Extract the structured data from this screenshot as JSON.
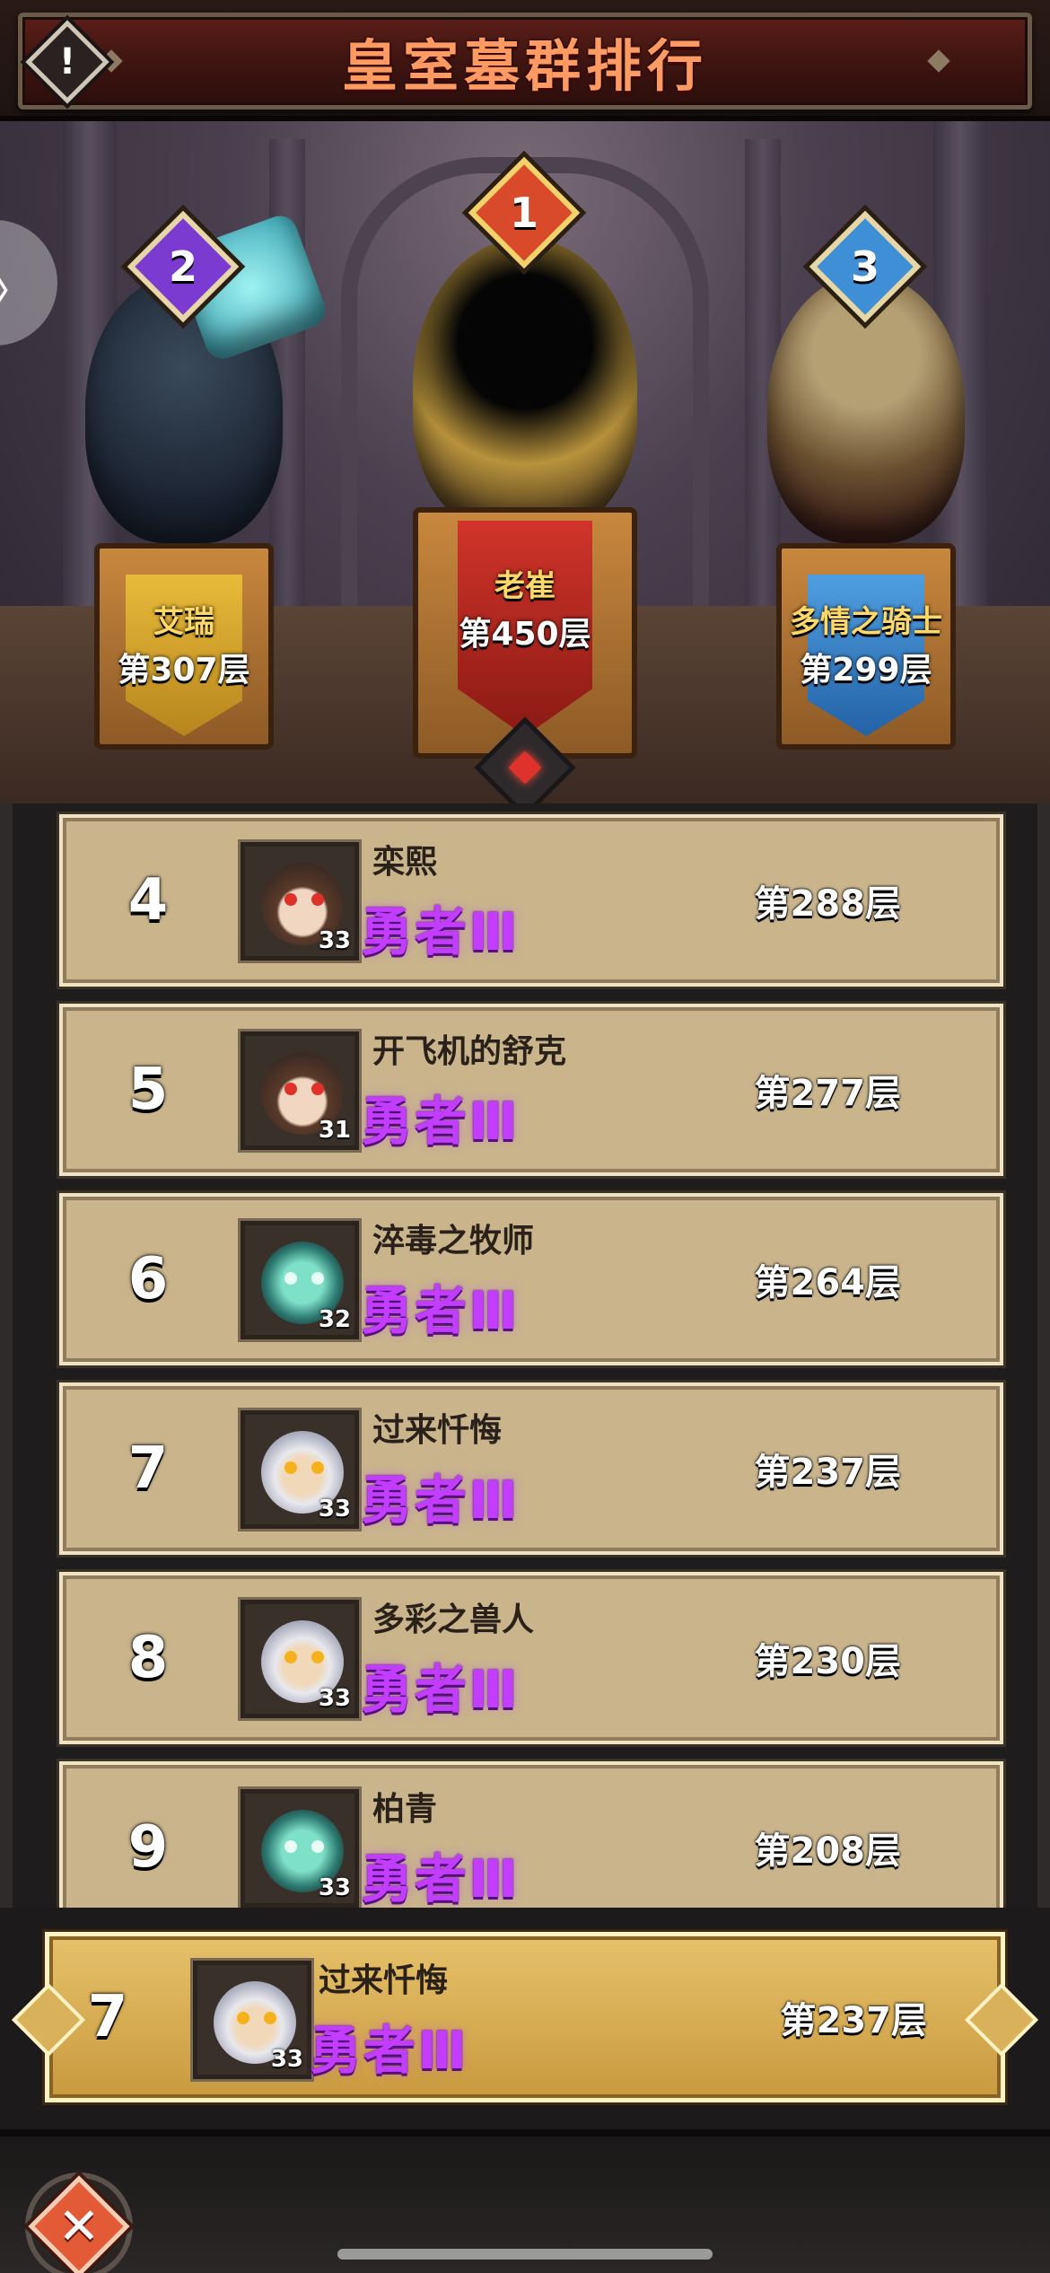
{
  "header": {
    "title": "皇室墓群排行",
    "info_icon": "!"
  },
  "side_tab": {
    "icon": "chevron-right",
    "glyph": "〉"
  },
  "podium": [
    {
      "rank": "2",
      "name": "艾瑞",
      "floor": "第307层",
      "badge_color": "#7b3bd1"
    },
    {
      "rank": "1",
      "name": "老崔",
      "floor": "第450层",
      "badge_color": "#d84a2a"
    },
    {
      "rank": "3",
      "name": "多情之骑士",
      "floor": "第299层",
      "badge_color": "#3f8fd6"
    }
  ],
  "rankings": [
    {
      "rank": "4",
      "name": "栾熙",
      "title": "勇者Ⅲ",
      "level": "33",
      "floor": "第288层",
      "avatar": "hooded"
    },
    {
      "rank": "5",
      "name": "开飞机的舒克",
      "title": "勇者Ⅲ",
      "level": "31",
      "floor": "第277层",
      "avatar": "hooded"
    },
    {
      "rank": "6",
      "name": "淬毒之牧师",
      "title": "勇者Ⅲ",
      "level": "32",
      "floor": "第264层",
      "avatar": "teal"
    },
    {
      "rank": "7",
      "name": "过来忏悔",
      "title": "勇者Ⅲ",
      "level": "33",
      "floor": "第237层",
      "avatar": "white"
    },
    {
      "rank": "8",
      "name": "多彩之兽人",
      "title": "勇者Ⅲ",
      "level": "33",
      "floor": "第230层",
      "avatar": "white"
    },
    {
      "rank": "9",
      "name": "柏青",
      "title": "勇者Ⅲ",
      "level": "33",
      "floor": "第208层",
      "avatar": "teal"
    }
  ],
  "self": {
    "rank": "7",
    "name": "过来忏悔",
    "title": "勇者Ⅲ",
    "level": "33",
    "floor": "第237层",
    "avatar": "white"
  },
  "close_button": {
    "glyph": "✕"
  },
  "colors": {
    "title_text": "#ff9a63",
    "rank_title_purple": "#c23dff",
    "row_bg": "#c9b48c",
    "self_row_bg": "#e6c16a"
  }
}
